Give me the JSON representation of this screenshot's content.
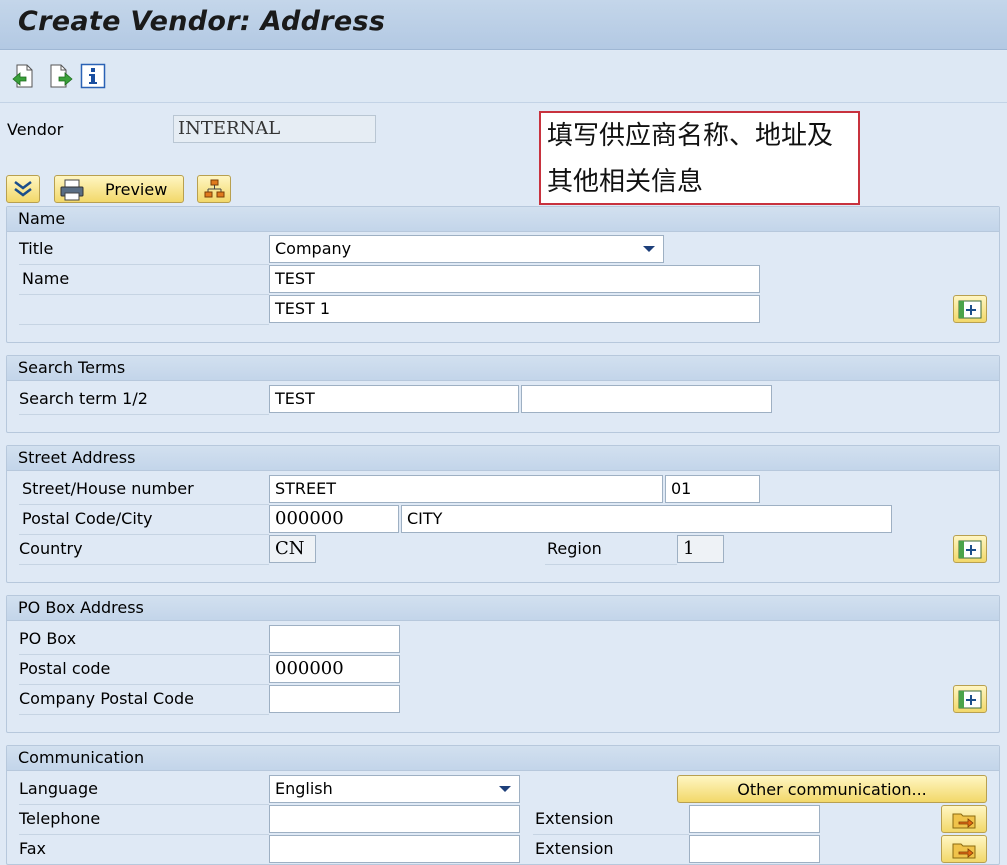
{
  "window": {
    "title": "Create Vendor: Address"
  },
  "toolbar": {
    "icons": [
      "previous-screen-icon",
      "next-screen-icon",
      "info-icon"
    ]
  },
  "vendor": {
    "label": "Vendor",
    "value": "INTERNAL"
  },
  "actions": {
    "preview_label": "Preview"
  },
  "callout": {
    "line1": "填写供应商名称、地址及",
    "line2": "其他相关信息"
  },
  "name_section": {
    "title": "Name",
    "title_label": "Title",
    "title_value": "Company",
    "name_label": "Name",
    "name1": "TEST",
    "name2": "TEST 1"
  },
  "search_section": {
    "title": "Search Terms",
    "label": "Search term 1/2",
    "term1": "TEST",
    "term2": ""
  },
  "street_section": {
    "title": "Street Address",
    "street_label": "Street/House number",
    "street": "STREET",
    "house_number": "01",
    "postal_label": "Postal Code/City",
    "postal_code": "000000",
    "city": "CITY",
    "country_label": "Country",
    "country": "CN",
    "region_label": "Region",
    "region": "1"
  },
  "pobox_section": {
    "title": "PO Box Address",
    "pobox_label": "PO Box",
    "pobox": "",
    "postal_label": "Postal code",
    "postal": "000000",
    "company_postal_label": "Company Postal Code",
    "company_postal": ""
  },
  "comm_section": {
    "title": "Communication",
    "language_label": "Language",
    "language": "English",
    "other_button": "Other communication...",
    "telephone_label": "Telephone",
    "telephone": "",
    "extension_label": "Extension",
    "extension": "",
    "fax_label": "Fax",
    "fax": "",
    "fax_extension_label": "Extension",
    "fax_extension": ""
  },
  "colors": {
    "title_bar": "#c4d6ea",
    "background": "#dfe9f5",
    "button": "#f2d86a",
    "callout_border": "#c8323e"
  }
}
